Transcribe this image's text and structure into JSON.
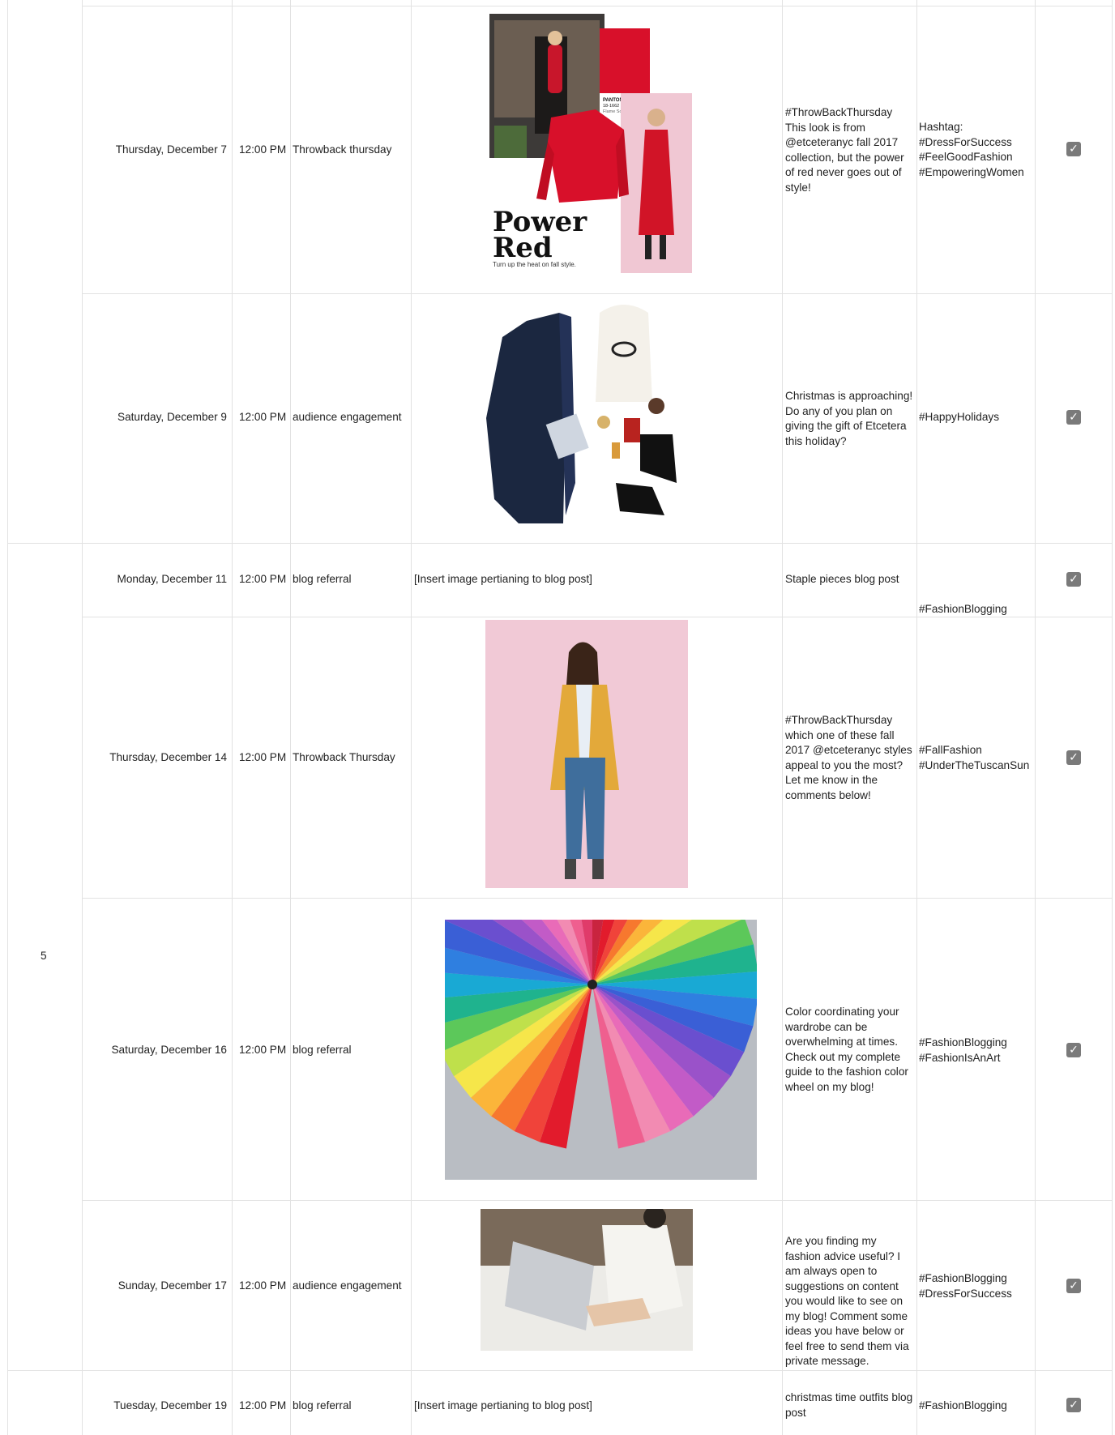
{
  "week_label": "5",
  "rows": [
    {
      "date": "Thursday, December 7",
      "time": "12:00 PM",
      "type": "Throwback thursday",
      "image_text": {
        "title_line1": "Power",
        "title_line2": "Red",
        "tagline": "Turn up the heat on fall style.",
        "swatch_brand": "PANTONE®",
        "swatch_code": "18-1662",
        "swatch_name": "Flame Scarlet"
      },
      "caption": "#ThrowBackThursday This look is from @etceteranyc fall 2017 collection, but the power of red never goes out of style!",
      "hashtags": "Hashtag:\n#DressForSuccess\n#FeelGoodFashion\n#EmpoweringWomen",
      "checked": true
    },
    {
      "date": "Saturday, December 9",
      "time": "12:00 PM",
      "type": "audience engagement",
      "caption": "Christmas is approaching! Do any of you plan on giving the gift of Etcetera this holiday?",
      "hashtags": "#HappyHolidays",
      "checked": true
    },
    {
      "date": "Monday, December 11",
      "time": "12:00 PM",
      "type": "blog referral",
      "image_placeholder": "[Insert image pertianing to blog post]",
      "caption": "Staple pieces blog post",
      "hashtags": "#FashionBlogging",
      "checked": true
    },
    {
      "date": "Thursday, December 14",
      "time": "12:00 PM",
      "type": "Throwback Thursday",
      "caption": "#ThrowBackThursday which one of these fall 2017 @etceteranyc styles appeal to you the most? Let me know in the comments below!",
      "hashtags": "#FallFashion\n#UnderTheTuscanSun",
      "checked": true
    },
    {
      "date": "Saturday, December 16",
      "time": "12:00 PM",
      "type": "blog referral",
      "caption": "Color coordinating your wardrobe can be overwhelming at times. Check out my complete guide to the fashion color wheel on my blog!",
      "hashtags": "#FashionBlogging\n#FashionIsAnArt",
      "checked": true
    },
    {
      "date": "Sunday, December 17",
      "time": "12:00 PM",
      "type": "audience engagement",
      "caption": "Are you finding my fashion advice useful? I am always open to suggestions on content you would like to see on my blog! Comment some ideas you have below or feel free to send them via private message.",
      "hashtags": "#FashionBlogging\n#DressForSuccess",
      "checked": true
    },
    {
      "date": "Tuesday, December 19",
      "time": "12:00 PM",
      "type": "blog referral",
      "image_placeholder": "[Insert image pertianing to blog post]",
      "caption": "christmas time outfits blog post",
      "hashtags": "#FashionBlogging",
      "checked": true
    }
  ],
  "colors": {
    "grid": "#e2e2e2",
    "check": "#7a7a7a",
    "red": "#d8102a",
    "navy": "#1b2740",
    "pink": "#f1c9d6",
    "mustard": "#e3a93a"
  }
}
